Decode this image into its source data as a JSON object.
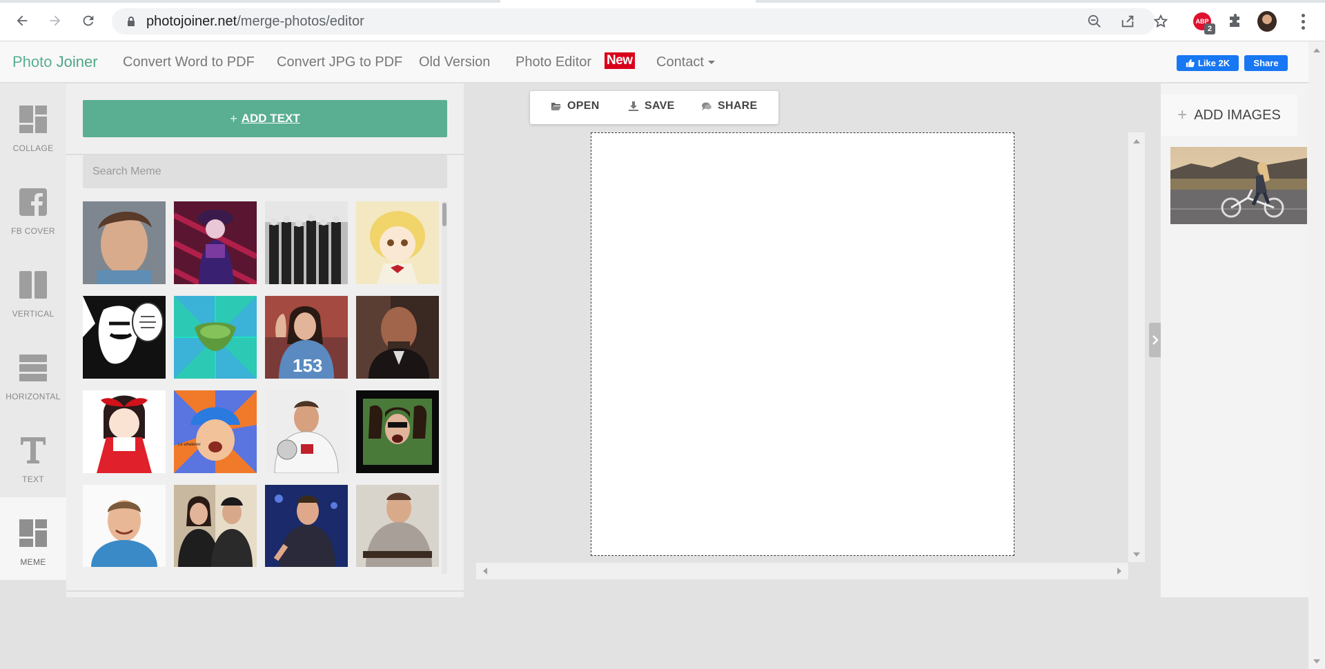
{
  "browser": {
    "url_host": "photojoiner.net",
    "url_path": "/merge-photos/editor",
    "extension_badge": "ABP",
    "extension_count": "2"
  },
  "header": {
    "brand_first": "Photo",
    "brand_second": "Joiner",
    "nav": [
      {
        "label": "Convert Word to PDF"
      },
      {
        "label": "Convert JPG to PDF"
      },
      {
        "label": "Old Version"
      },
      {
        "label": "Photo Editor"
      },
      {
        "label": "Contact"
      }
    ],
    "new_badge": "New",
    "fb_like": "Like 2K",
    "fb_share": "Share"
  },
  "tools": [
    {
      "label": "COLLAGE",
      "icon": "collage-icon"
    },
    {
      "label": "FB COVER",
      "icon": "facebook-icon"
    },
    {
      "label": "VERTICAL",
      "icon": "vertical-columns-icon"
    },
    {
      "label": "HORIZONTAL",
      "icon": "horizontal-rows-icon"
    },
    {
      "label": "TEXT",
      "icon": "text-icon"
    },
    {
      "label": "MEME",
      "icon": "meme-icon",
      "active": true
    }
  ],
  "meme_panel": {
    "add_text_label": "ADD TEXT",
    "search_placeholder": "Search Meme"
  },
  "editor": {
    "open_label": "OPEN",
    "save_label": "SAVE",
    "share_label": "SHARE"
  },
  "images_panel": {
    "add_images_label": "ADD IMAGES"
  },
  "colors": {
    "brand_green": "#5aaf92",
    "new_badge_red": "#d9001b",
    "facebook_blue": "#1877f2"
  }
}
